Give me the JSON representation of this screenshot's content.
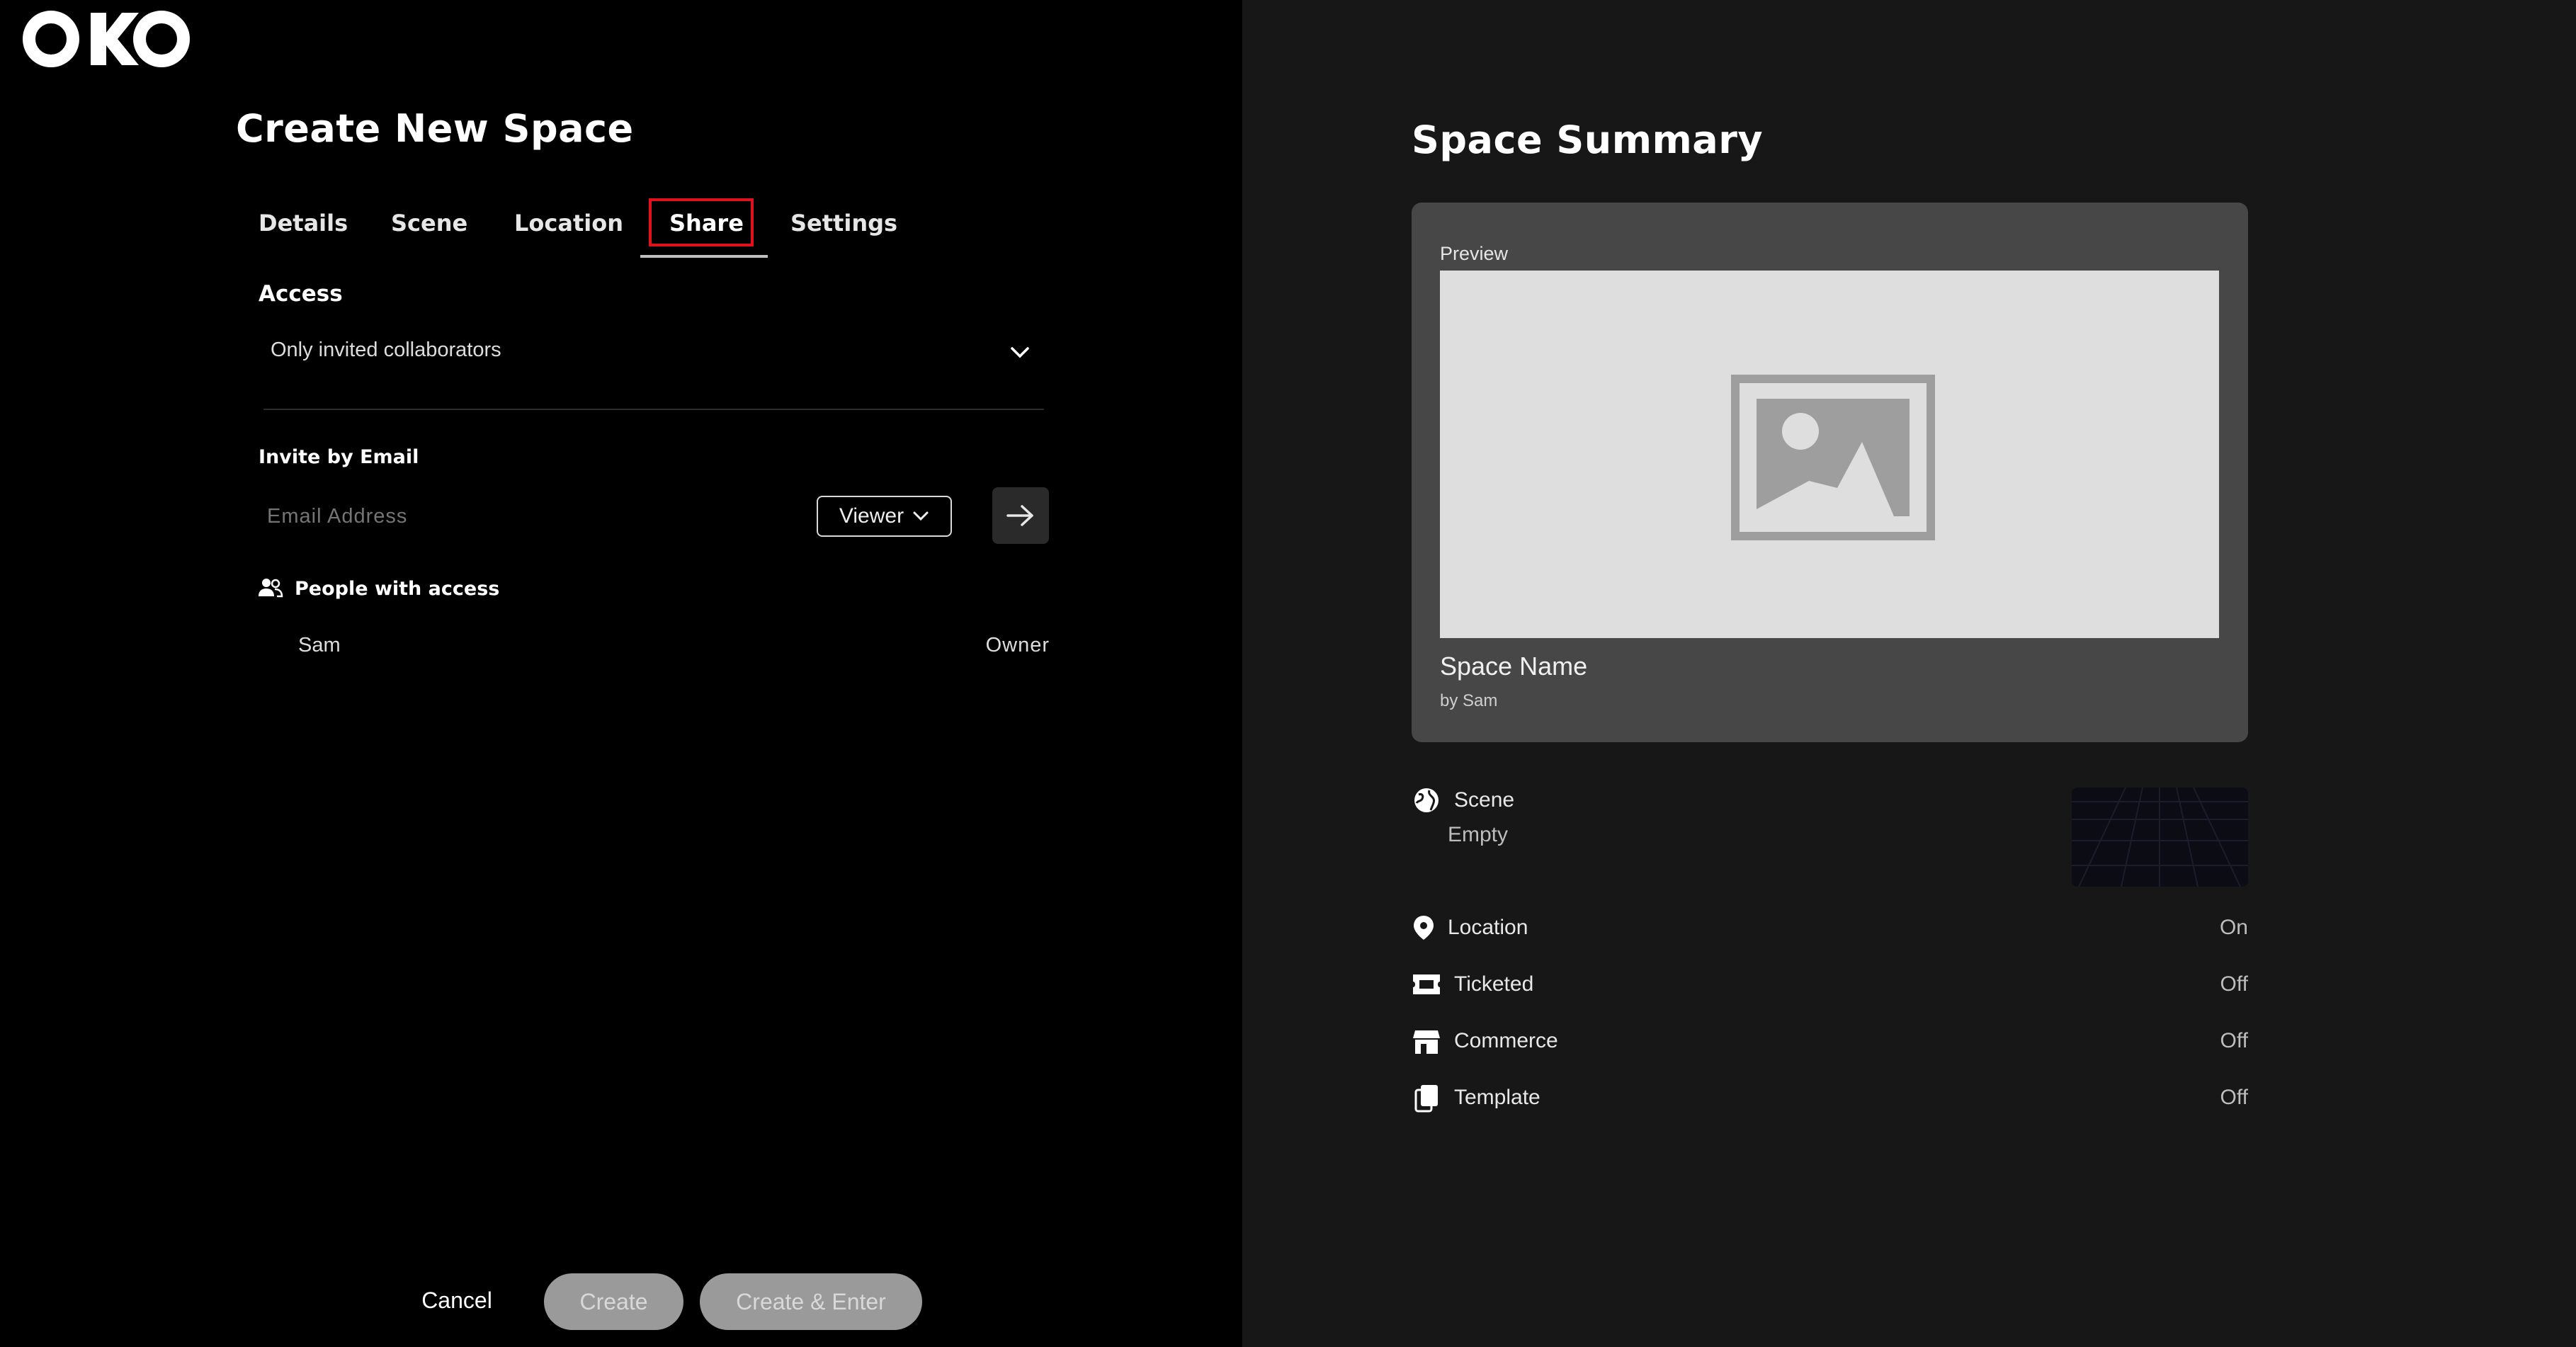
{
  "app": {
    "logo_text": "OKO"
  },
  "form": {
    "title": "Create New Space",
    "tabs": [
      {
        "label": "Details"
      },
      {
        "label": "Scene"
      },
      {
        "label": "Location"
      },
      {
        "label": "Share",
        "active": true
      },
      {
        "label": "Settings"
      }
    ],
    "access": {
      "label": "Access",
      "selected": "Only invited collaborators"
    },
    "invite": {
      "label": "Invite by Email",
      "placeholder": "Email Address",
      "role_selected": "Viewer"
    },
    "people": {
      "label": "People with access",
      "list": [
        {
          "name": "Sam",
          "role": "Owner"
        }
      ]
    },
    "actions": {
      "cancel": "Cancel",
      "create": "Create",
      "create_enter": "Create & Enter"
    }
  },
  "summary": {
    "title": "Space Summary",
    "preview_label": "Preview",
    "space_name": "Space Name",
    "by_line": "by Sam",
    "scene": {
      "label": "Scene",
      "value": "Empty"
    },
    "rows": [
      {
        "label": "Location",
        "value": "On",
        "icon": "location-pin-icon"
      },
      {
        "label": "Ticketed",
        "value": "Off",
        "icon": "ticket-icon"
      },
      {
        "label": "Commerce",
        "value": "Off",
        "icon": "store-icon"
      },
      {
        "label": "Template",
        "value": "Off",
        "icon": "copy-icon"
      }
    ]
  },
  "colors": {
    "left_bg": "#000000",
    "right_bg": "#171717",
    "active_tab_highlight": "#e0111c",
    "card_bg": "#474747",
    "disabled_button": "#9a9a9a"
  }
}
